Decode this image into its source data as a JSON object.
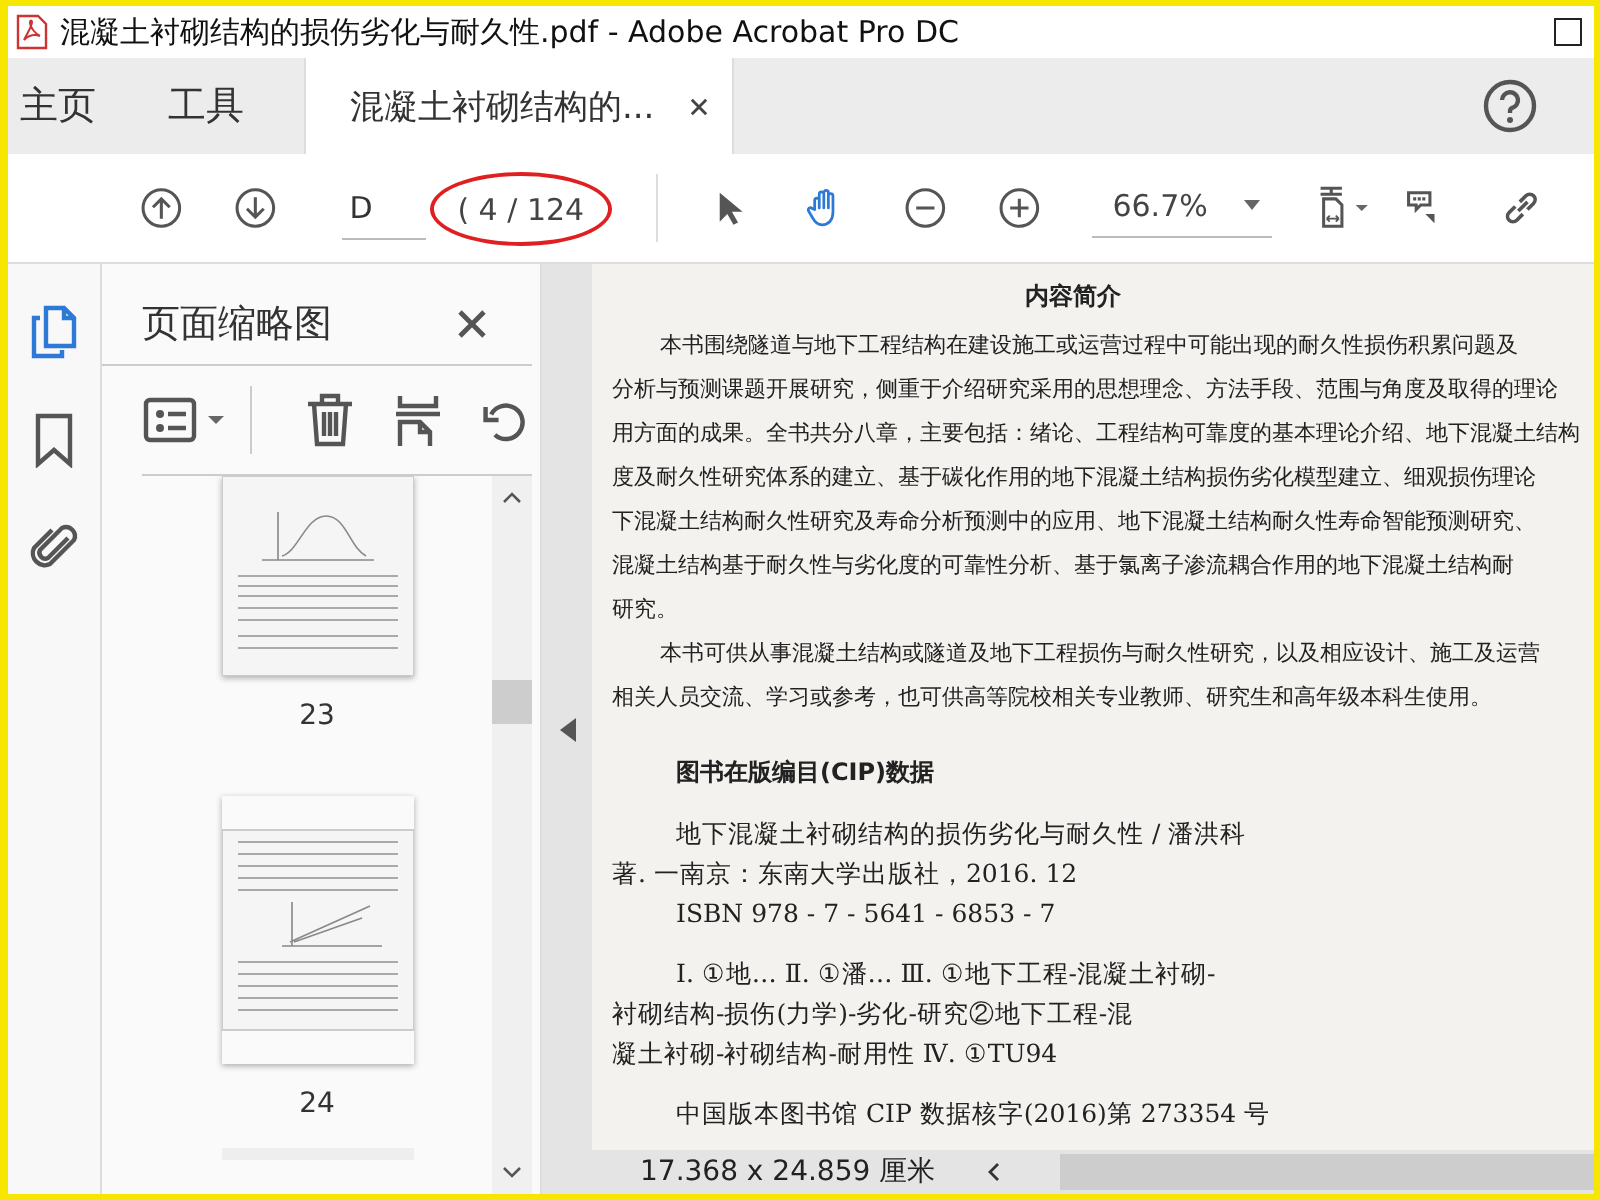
{
  "window": {
    "title": "混凝土衬砌结构的损伤劣化与耐久性.pdf - Adobe Acrobat Pro DC"
  },
  "tabs": [
    {
      "label": "主页",
      "selected": false,
      "kind": "nav"
    },
    {
      "label": "工具",
      "selected": false,
      "kind": "nav"
    },
    {
      "label": "混凝土衬砌结构的...",
      "selected": true,
      "kind": "document"
    }
  ],
  "toolbar": {
    "page_field": {
      "value": "D"
    },
    "page_count": "( 4 / 124",
    "tools": [
      {
        "kind": "select",
        "selected": false
      },
      {
        "kind": "hand",
        "selected": true
      }
    ],
    "zoom": "66.7%"
  },
  "sidebar": {
    "rail": [
      {
        "kind": "pages",
        "selected": true
      },
      {
        "kind": "bookmarks",
        "selected": false
      },
      {
        "kind": "attachments",
        "selected": false
      }
    ],
    "panel": {
      "title": "页面缩略图",
      "thumbnails": [
        {
          "label": "23",
          "kind": "chart"
        },
        {
          "label": "24",
          "kind": "plot"
        }
      ]
    }
  },
  "document": {
    "heading": "内容简介",
    "lines": [
      {
        "text": "本书围绕隧道与地下工程结构在建设施工或运营过程中可能出现的耐久性损伤积累问题及",
        "indent": true
      },
      {
        "text": "分析与预测课题开展研究，侧重于介绍研究采用的思想理念、方法手段、范围与角度及取得的理论",
        "indent": false
      },
      {
        "text": "用方面的成果。全书共分八章，主要包括：绪论、工程结构可靠度的基本理论介绍、地下混凝土结构",
        "indent": false
      },
      {
        "text": "度及耐久性研究体系的建立、基于碳化作用的地下混凝土结构损伤劣化模型建立、细观损伤理论",
        "indent": false
      },
      {
        "text": "下混凝土结构耐久性研究及寿命分析预测中的应用、地下混凝土结构耐久性寿命智能预测研究、",
        "indent": false
      },
      {
        "text": "混凝土结构基于耐久性与劣化度的可靠性分析、基于氯离子渗流耦合作用的地下混凝土结构耐",
        "indent": false
      },
      {
        "text": "研究。",
        "indent": false
      },
      {
        "text": "本书可供从事混凝土结构或隧道及地下工程损伤与耐久性研究，以及相应设计、施工及运营",
        "indent": true
      },
      {
        "text": "相关人员交流、学习或参考，也可供高等院校相关专业教师、研究生和高年级本科生使用。",
        "indent": false
      }
    ],
    "cip_heading": "图书在版编目(CIP)数据",
    "cip_blocks": [
      [
        {
          "text": "地下混凝土衬砌结构的损伤劣化与耐久性 / 潘洪科",
          "indent": true
        },
        {
          "text": "著. 一南京：东南大学出版社，2016. 12",
          "indent": false
        },
        {
          "text": "ISBN 978 - 7 - 5641 - 6853 - 7",
          "indent": true
        }
      ],
      [
        {
          "text": "Ⅰ. ①地…  Ⅱ. ①潘…  Ⅲ. ①地下工程-混凝土衬砌-",
          "indent": true
        },
        {
          "text": "衬砌结构-损伤(力学)-劣化-研究②地下工程-混",
          "indent": false
        },
        {
          "text": "凝土衬砌-衬砌结构-耐用性  Ⅳ. ①TU94",
          "indent": false
        }
      ],
      [
        {
          "text": "中国版本图书馆 CIP 数据核字(2016)第 273354 号",
          "indent": true
        }
      ]
    ]
  },
  "status_bar": {
    "page_size": "17.368 x 24.859 厘米"
  }
}
